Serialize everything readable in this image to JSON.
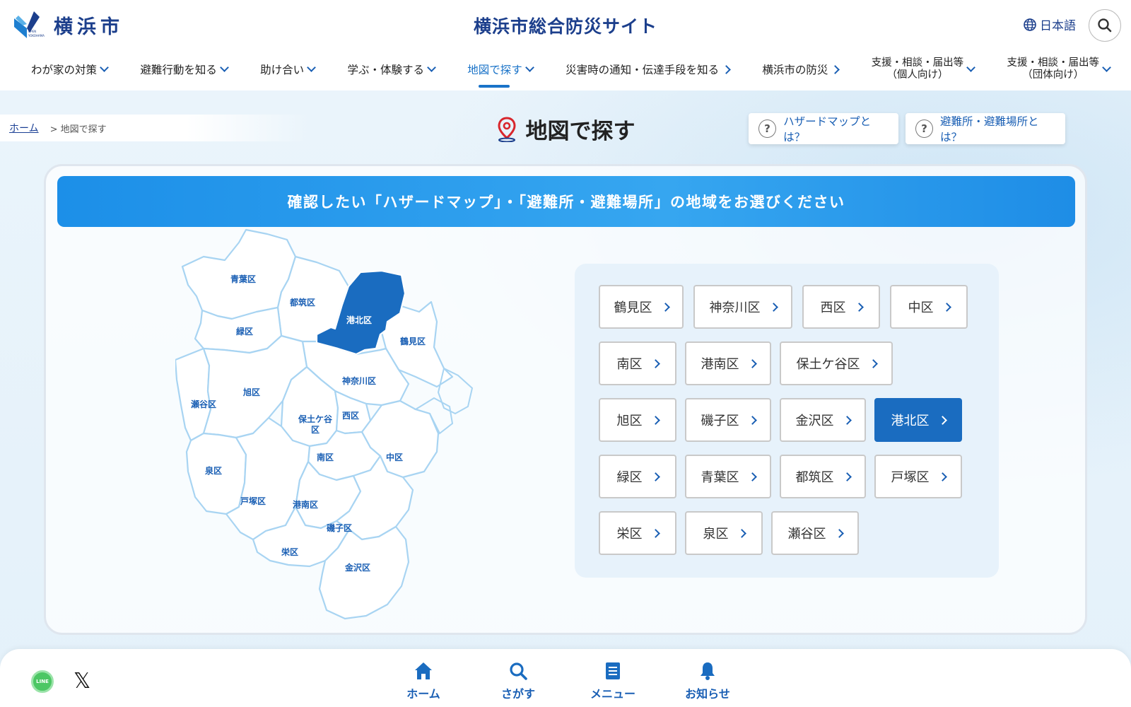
{
  "header": {
    "logo_text": "横浜市",
    "logo_mark_text": "OPEN YOKOHAMA",
    "site_title": "横浜市総合防災サイト",
    "language": "日本語"
  },
  "nav": {
    "items": [
      {
        "label": "わが家の対策"
      },
      {
        "label": "避難行動を知る"
      },
      {
        "label": "助け合い"
      },
      {
        "label": "学ぶ・体験する"
      },
      {
        "label": "地図で探す",
        "active": true
      },
      {
        "label": "災害時の通知・伝達手段を知る"
      },
      {
        "label": "横浜市の防災"
      },
      {
        "line1": "支援・相談・届出等",
        "line2": "（個人向け）"
      },
      {
        "line1": "支援・相談・届出等",
        "line2": "（団体向け）"
      }
    ]
  },
  "breadcrumb": {
    "home": "ホーム",
    "separator": ">",
    "current": "地図で探す"
  },
  "page_title": "地図で探す",
  "help_buttons": {
    "hazard": "ハザードマップとは？",
    "shelter": "避難所・避難場所とは？",
    "q": "?"
  },
  "banner": "確認したい「ハザードマップ」・「避難所・避難場所」の地域をお選びください",
  "map_labels": {
    "aoba": "青葉区",
    "tsuzuki": "都筑区",
    "kohoku": "港北区",
    "midori": "緑区",
    "tsurumi": "鶴見区",
    "kanagawa": "神奈川区",
    "asahi": "旭区",
    "seya": "瀬谷区",
    "hodogaya1": "保土ケ谷",
    "hodogaya2": "区",
    "nishi": "西区",
    "minami": "南区",
    "naka": "中区",
    "izumi": "泉区",
    "totsuka": "戸塚区",
    "konan": "港南区",
    "isogo": "磯子区",
    "sakae": "栄区",
    "kanazawa": "金沢区"
  },
  "wards": [
    {
      "label": "鶴見区"
    },
    {
      "label": "神奈川区"
    },
    {
      "label": "西区"
    },
    {
      "label": "中区"
    },
    {
      "label": "南区"
    },
    {
      "label": "港南区"
    },
    {
      "label": "保土ケ谷区"
    },
    {
      "label": "旭区"
    },
    {
      "label": "磯子区"
    },
    {
      "label": "金沢区"
    },
    {
      "label": "港北区",
      "selected": true
    },
    {
      "label": "緑区"
    },
    {
      "label": "青葉区"
    },
    {
      "label": "都筑区"
    },
    {
      "label": "戸塚区"
    },
    {
      "label": "栄区"
    },
    {
      "label": "泉区"
    },
    {
      "label": "瀬谷区"
    }
  ],
  "bottom_nav": {
    "home": "ホーム",
    "search": "さがす",
    "menu": "メニュー",
    "news": "お知らせ",
    "line_label": "LINE",
    "x_label": "𝕏"
  },
  "colors": {
    "accent": "#1a6cc0",
    "title": "#1c3f8c",
    "banner": "#2a9bec"
  }
}
